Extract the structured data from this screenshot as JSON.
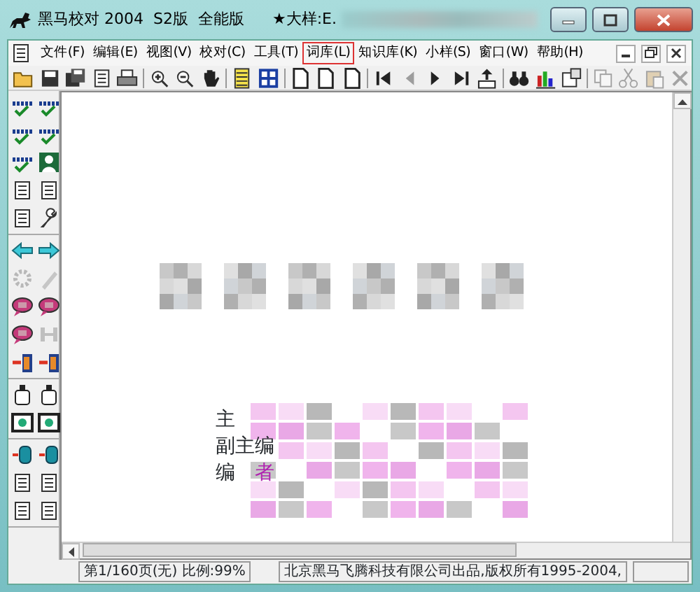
{
  "window": {
    "title": "黑马校对 2004  S2版  全能版",
    "document_title": "★大样:E."
  },
  "menu": [
    {
      "label": "文件(F)",
      "selected": false
    },
    {
      "label": "编辑(E)",
      "selected": false
    },
    {
      "label": "视图(V)",
      "selected": false
    },
    {
      "label": "校对(C)",
      "selected": false
    },
    {
      "label": "工具(T)",
      "selected": false
    },
    {
      "label": "词库(L)",
      "selected": true
    },
    {
      "label": "知识库(K)",
      "selected": false
    },
    {
      "label": "小样(S)",
      "selected": false
    },
    {
      "label": "窗口(W)",
      "selected": false
    },
    {
      "label": "帮助(H)",
      "selected": false
    }
  ],
  "toolbar": [
    {
      "kind": "open",
      "disabled": false
    },
    {
      "kind": "save",
      "disabled": false
    },
    {
      "kind": "saveall",
      "disabled": false
    },
    {
      "kind": "doc",
      "disabled": false
    },
    {
      "kind": "print",
      "disabled": false
    },
    {
      "kind": "sep"
    },
    {
      "kind": "zoomin",
      "disabled": false
    },
    {
      "kind": "zoomout",
      "disabled": false
    },
    {
      "kind": "hand",
      "disabled": false
    },
    {
      "kind": "sep"
    },
    {
      "kind": "list",
      "disabled": false
    },
    {
      "kind": "grid",
      "disabled": false
    },
    {
      "kind": "sep"
    },
    {
      "kind": "page",
      "disabled": false
    },
    {
      "kind": "page",
      "disabled": false
    },
    {
      "kind": "page",
      "disabled": false
    },
    {
      "kind": "sep"
    },
    {
      "kind": "first",
      "disabled": false
    },
    {
      "kind": "prev",
      "disabled": true
    },
    {
      "kind": "next",
      "disabled": false
    },
    {
      "kind": "last",
      "disabled": false
    },
    {
      "kind": "export",
      "disabled": false
    },
    {
      "kind": "sep"
    },
    {
      "kind": "find",
      "disabled": false
    },
    {
      "kind": "chart",
      "disabled": false
    },
    {
      "kind": "info",
      "disabled": false
    },
    {
      "kind": "sep"
    },
    {
      "kind": "copy",
      "disabled": true
    },
    {
      "kind": "cut",
      "disabled": true
    },
    {
      "kind": "paste",
      "disabled": true
    },
    {
      "kind": "delete",
      "disabled": true
    }
  ],
  "palette": [
    [
      {
        "kind": "check",
        "disabled": false
      },
      {
        "kind": "check",
        "disabled": false
      },
      {
        "kind": "check",
        "disabled": false
      },
      {
        "kind": "check",
        "disabled": false
      },
      {
        "kind": "check",
        "disabled": false
      },
      {
        "kind": "person",
        "disabled": false
      },
      {
        "kind": "doc",
        "disabled": false
      },
      {
        "kind": "doc",
        "disabled": false
      },
      {
        "kind": "doc",
        "disabled": false
      },
      {
        "kind": "wrench",
        "disabled": false
      }
    ],
    [
      {
        "kind": "left",
        "disabled": false
      },
      {
        "kind": "right",
        "disabled": false
      },
      {
        "kind": "gear",
        "disabled": true
      },
      {
        "kind": "pen",
        "disabled": true
      },
      {
        "kind": "bubble",
        "disabled": false
      },
      {
        "kind": "bubble",
        "disabled": false
      },
      {
        "kind": "bubble",
        "disabled": false
      },
      {
        "kind": "bar",
        "disabled": true
      },
      {
        "kind": "door",
        "disabled": false
      },
      {
        "kind": "door",
        "disabled": false
      }
    ],
    [
      {
        "kind": "bottle",
        "disabled": false
      },
      {
        "kind": "bottle",
        "disabled": false
      },
      {
        "kind": "frame",
        "disabled": false
      },
      {
        "kind": "frame",
        "disabled": false
      }
    ],
    [
      {
        "kind": "cylinder",
        "disabled": false
      },
      {
        "kind": "cylinder",
        "disabled": false
      },
      {
        "kind": "doc",
        "disabled": false
      },
      {
        "kind": "doc",
        "disabled": false
      },
      {
        "kind": "doc",
        "disabled": false
      },
      {
        "kind": "doc",
        "disabled": false
      }
    ]
  ],
  "document": {
    "credits": [
      {
        "parts": [
          {
            "text": "主",
            "highlighted": false
          }
        ]
      },
      {
        "parts": [
          {
            "text": "副主编",
            "highlighted": false
          }
        ]
      },
      {
        "parts": [
          {
            "text": "编",
            "highlighted": false
          },
          {
            "text": "者",
            "highlighted": true
          }
        ]
      }
    ]
  },
  "status_bar": [
    "第1/160页(无) 比例:99%",
    "北京黑马飞腾科技有限公司出品,版权所有1995-2004,"
  ]
}
